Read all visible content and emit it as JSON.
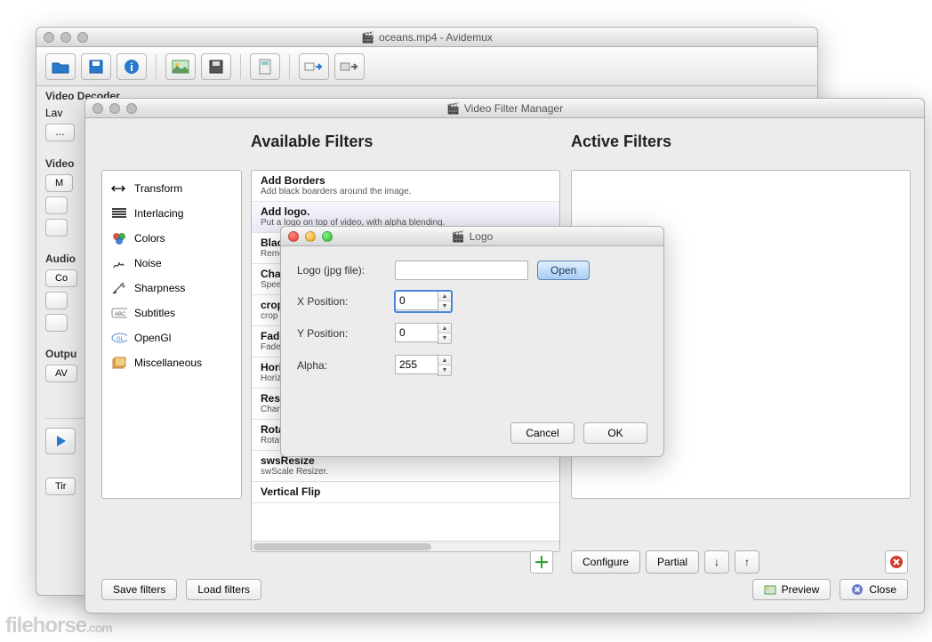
{
  "main": {
    "title": "oceans.mp4 - Avidemux",
    "side": {
      "decoder_label": "Video Decoder",
      "decoder_val": "Lav",
      "video_label": "Video",
      "video_val": "M",
      "audio_label": "Audio",
      "audio_val": "Co",
      "output_label": "Outpu",
      "output_val": "AV",
      "time_btn": "Tir"
    }
  },
  "vfm": {
    "title": "Video Filter Manager",
    "heading_avail": "Available Filters",
    "heading_active": "Active Filters",
    "categories": [
      {
        "label": "Transform",
        "icon": "transform"
      },
      {
        "label": "Interlacing",
        "icon": "interlacing"
      },
      {
        "label": "Colors",
        "icon": "colors"
      },
      {
        "label": "Noise",
        "icon": "noise"
      },
      {
        "label": "Sharpness",
        "icon": "sharpness"
      },
      {
        "label": "Subtitles",
        "icon": "subtitles"
      },
      {
        "label": "OpenGl",
        "icon": "opengl"
      },
      {
        "label": "Miscellaneous",
        "icon": "misc"
      }
    ],
    "filters": [
      {
        "name": "Add Borders",
        "desc": "Add black boarders around the image."
      },
      {
        "name": "Add logo.",
        "desc": "Put a logo on top of video, with alpha blending.",
        "sel": true
      },
      {
        "name": "Blacken Bo",
        "desc": "Remove noisy"
      },
      {
        "name": "Change FP",
        "desc": "Speed up/slow"
      },
      {
        "name": "crop",
        "desc": "crop filter"
      },
      {
        "name": "Fade",
        "desc": "Fade in/out."
      },
      {
        "name": "Horizontal",
        "desc": "Horizontally fl"
      },
      {
        "name": "Resample",
        "desc": "Change and er"
      },
      {
        "name": "Rotate",
        "desc": "Rotate the ima"
      },
      {
        "name": "swsResize",
        "desc": "swScale Resizer."
      },
      {
        "name": "Vertical Flip",
        "desc": ""
      }
    ],
    "btn_configure": "Configure",
    "btn_partial": "Partial",
    "btn_save": "Save filters",
    "btn_load": "Load filters",
    "btn_preview": "Preview",
    "btn_close": "Close"
  },
  "logo": {
    "title": "Logo",
    "label_file": "Logo (jpg file):",
    "file_val": "",
    "btn_open": "Open",
    "label_x": "X Position:",
    "x_val": "0",
    "label_y": "Y Position:",
    "y_val": "0",
    "label_alpha": "Alpha:",
    "alpha_val": "255",
    "btn_cancel": "Cancel",
    "btn_ok": "OK"
  },
  "watermark": {
    "a": "filehorse",
    "b": ".com"
  }
}
